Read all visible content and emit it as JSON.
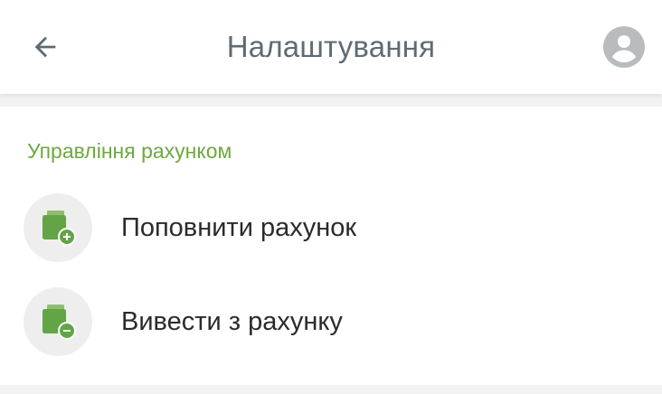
{
  "header": {
    "title": "Налаштування",
    "back_icon": "arrow-left-icon",
    "account_icon": "account-circle-icon"
  },
  "account_section": {
    "title": "Управління рахунком",
    "items": [
      {
        "label": "Поповнити рахунок",
        "icon": "wallet-plus-icon"
      },
      {
        "label": "Вивести з рахунку",
        "icon": "wallet-minus-icon"
      }
    ]
  },
  "colors": {
    "accent_green": "#6ea83f",
    "icon_green": "#63a446",
    "title_gray": "#5f6b72",
    "icon_gray": "#b9bcbe"
  }
}
